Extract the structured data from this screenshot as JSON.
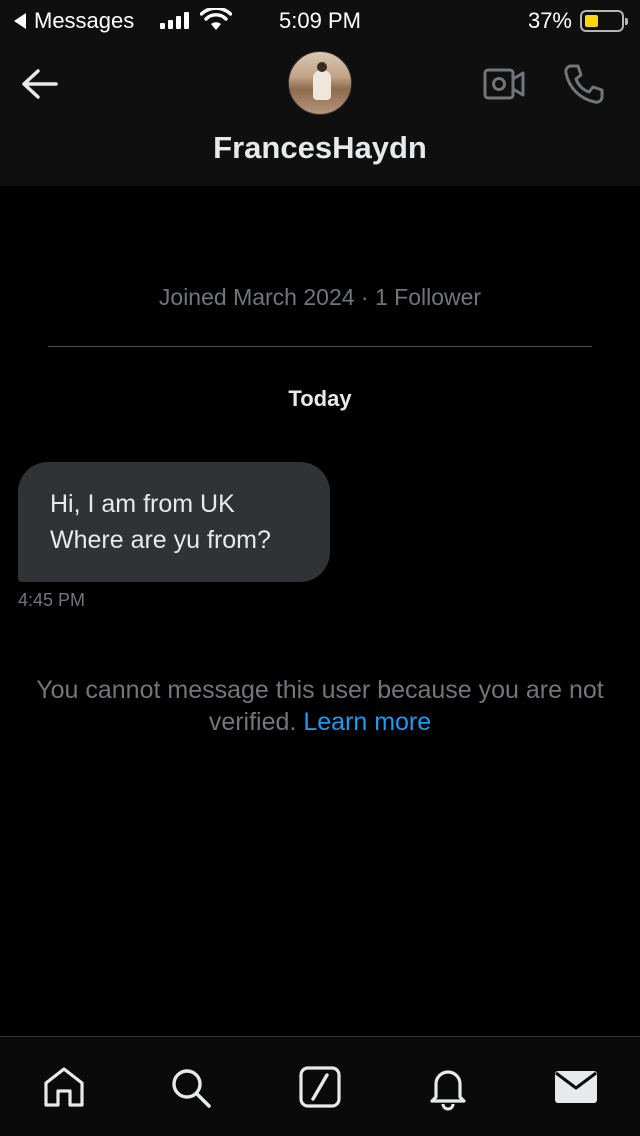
{
  "status_bar": {
    "back_app": "Messages",
    "time": "5:09 PM",
    "battery_percent": "37%",
    "battery_level": 0.37,
    "battery_color": "#ffd60a"
  },
  "header": {
    "contact_name": "FrancesHaydn",
    "icons": [
      "back-arrow-icon",
      "video-call-icon",
      "phone-call-icon"
    ]
  },
  "profile_info": {
    "joined": "Joined March 2024 · 1 Follower"
  },
  "conversation": {
    "day_label": "Today",
    "messages": [
      {
        "lines": [
          "Hi, I am from UK",
          "Where are yu from?"
        ],
        "time": "4:45 PM"
      }
    ]
  },
  "notice": {
    "text": "You cannot message this user because you are not verified.",
    "link_text": "Learn more",
    "link_color": "#1d9bf0"
  },
  "tabbar": {
    "icons": [
      "home-icon",
      "search-icon",
      "compose-icon",
      "notifications-icon",
      "messages-icon"
    ],
    "active": "messages-icon"
  }
}
